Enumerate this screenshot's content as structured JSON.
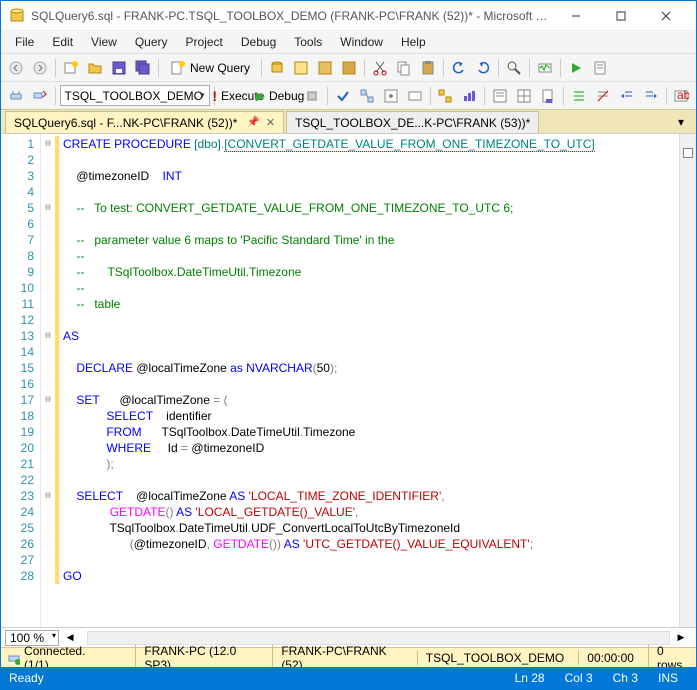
{
  "window": {
    "title": "SQLQuery6.sql - FRANK-PC.TSQL_TOOLBOX_DEMO (FRANK-PC\\FRANK (52))* - Microsoft SQL Ser..."
  },
  "menu": {
    "file": "File",
    "edit": "Edit",
    "view": "View",
    "query": "Query",
    "project": "Project",
    "debug": "Debug",
    "tools": "Tools",
    "window": "Window",
    "help": "Help"
  },
  "toolbar": {
    "new_query": "New Query",
    "execute": "Execute",
    "debug": "Debug",
    "database": "TSQL_TOOLBOX_DEMO"
  },
  "tabs": [
    {
      "label": "SQLQuery6.sql - F...NK-PC\\FRANK (52))*",
      "active": true
    },
    {
      "label": "TSQL_TOOLBOX_DE...K-PC\\FRANK (53))*",
      "active": false
    }
  ],
  "code": {
    "lines": [
      {
        "n": 1,
        "f": "⊟",
        "ch": "y",
        "s": [
          {
            "c": "kw",
            "t": "CREATE"
          },
          {
            "c": "",
            "t": " "
          },
          {
            "c": "kw",
            "t": "PROCEDURE"
          },
          {
            "c": "",
            "t": " "
          },
          {
            "c": "obj",
            "t": "[dbo]"
          },
          {
            "c": "op",
            "t": "."
          },
          {
            "c": "obj red-squig",
            "t": "[CONVERT_GETDATE_VALUE_FROM_ONE_TIMEZONE_TO_UTC]"
          }
        ]
      },
      {
        "n": 2,
        "f": "",
        "ch": "y",
        "s": []
      },
      {
        "n": 3,
        "f": "",
        "ch": "y",
        "s": [
          {
            "c": "",
            "t": "    @timezoneID    "
          },
          {
            "c": "kw",
            "t": "INT"
          }
        ]
      },
      {
        "n": 4,
        "f": "",
        "ch": "y",
        "s": []
      },
      {
        "n": 5,
        "f": "⊟",
        "ch": "y",
        "s": [
          {
            "c": "",
            "t": "    "
          },
          {
            "c": "com",
            "t": "--   To test: CONVERT_GETDATE_VALUE_FROM_ONE_TIMEZONE_TO_UTC 6;"
          }
        ]
      },
      {
        "n": 6,
        "f": "",
        "ch": "y",
        "s": []
      },
      {
        "n": 7,
        "f": "",
        "ch": "y",
        "s": [
          {
            "c": "",
            "t": "    "
          },
          {
            "c": "com",
            "t": "--   parameter value 6 maps to 'Pacific Standard Time' in the"
          }
        ]
      },
      {
        "n": 8,
        "f": "",
        "ch": "y",
        "s": [
          {
            "c": "",
            "t": "    "
          },
          {
            "c": "com",
            "t": "--"
          }
        ]
      },
      {
        "n": 9,
        "f": "",
        "ch": "y",
        "s": [
          {
            "c": "",
            "t": "    "
          },
          {
            "c": "com",
            "t": "--       TSqlToolbox.DateTimeUtil.Timezone"
          }
        ]
      },
      {
        "n": 10,
        "f": "",
        "ch": "y",
        "s": [
          {
            "c": "",
            "t": "    "
          },
          {
            "c": "com",
            "t": "--"
          }
        ]
      },
      {
        "n": 11,
        "f": "",
        "ch": "y",
        "s": [
          {
            "c": "",
            "t": "    "
          },
          {
            "c": "com",
            "t": "--   table"
          }
        ]
      },
      {
        "n": 12,
        "f": "",
        "ch": "y",
        "s": []
      },
      {
        "n": 13,
        "f": "⊟",
        "ch": "y",
        "s": [
          {
            "c": "kw",
            "t": "AS"
          }
        ]
      },
      {
        "n": 14,
        "f": "",
        "ch": "y",
        "s": []
      },
      {
        "n": 15,
        "f": "",
        "ch": "y",
        "s": [
          {
            "c": "",
            "t": "    "
          },
          {
            "c": "kw",
            "t": "DECLARE"
          },
          {
            "c": "",
            "t": " @localTimeZone "
          },
          {
            "c": "kw",
            "t": "as"
          },
          {
            "c": "",
            "t": " "
          },
          {
            "c": "kw",
            "t": "NVARCHAR"
          },
          {
            "c": "op",
            "t": "("
          },
          {
            "c": "num",
            "t": "50"
          },
          {
            "c": "op",
            "t": ");"
          }
        ]
      },
      {
        "n": 16,
        "f": "",
        "ch": "y",
        "s": []
      },
      {
        "n": 17,
        "f": "⊟",
        "ch": "y",
        "s": [
          {
            "c": "",
            "t": "    "
          },
          {
            "c": "kw",
            "t": "SET"
          },
          {
            "c": "",
            "t": "      @localTimeZone "
          },
          {
            "c": "op",
            "t": "= ("
          }
        ]
      },
      {
        "n": 18,
        "f": "",
        "ch": "y",
        "s": [
          {
            "c": "",
            "t": "             "
          },
          {
            "c": "kw",
            "t": "SELECT"
          },
          {
            "c": "",
            "t": "    identifier"
          }
        ]
      },
      {
        "n": 19,
        "f": "",
        "ch": "y",
        "s": [
          {
            "c": "",
            "t": "             "
          },
          {
            "c": "kw",
            "t": "FROM"
          },
          {
            "c": "",
            "t": "      TSqlToolbox"
          },
          {
            "c": "op",
            "t": "."
          },
          {
            "c": "",
            "t": "DateTimeUtil"
          },
          {
            "c": "op",
            "t": "."
          },
          {
            "c": "",
            "t": "Timezone"
          }
        ]
      },
      {
        "n": 20,
        "f": "",
        "ch": "y",
        "s": [
          {
            "c": "",
            "t": "             "
          },
          {
            "c": "kw",
            "t": "WHERE"
          },
          {
            "c": "",
            "t": "     Id "
          },
          {
            "c": "op",
            "t": "="
          },
          {
            "c": "",
            "t": " @timezoneID"
          }
        ]
      },
      {
        "n": 21,
        "f": "",
        "ch": "y",
        "s": [
          {
            "c": "",
            "t": "             "
          },
          {
            "c": "op",
            "t": ");"
          }
        ]
      },
      {
        "n": 22,
        "f": "",
        "ch": "y",
        "s": []
      },
      {
        "n": 23,
        "f": "⊟",
        "ch": "y",
        "s": [
          {
            "c": "",
            "t": "    "
          },
          {
            "c": "kw",
            "t": "SELECT"
          },
          {
            "c": "",
            "t": "    @localTimeZone "
          },
          {
            "c": "kw",
            "t": "AS"
          },
          {
            "c": "",
            "t": " "
          },
          {
            "c": "str",
            "t": "'LOCAL_TIME_ZONE_IDENTIFIER'"
          },
          {
            "c": "op",
            "t": ","
          }
        ]
      },
      {
        "n": 24,
        "f": "",
        "ch": "y",
        "s": [
          {
            "c": "",
            "t": "              "
          },
          {
            "c": "func",
            "t": "GETDATE"
          },
          {
            "c": "op",
            "t": "()"
          },
          {
            "c": "",
            "t": " "
          },
          {
            "c": "kw",
            "t": "AS"
          },
          {
            "c": "",
            "t": " "
          },
          {
            "c": "str",
            "t": "'LOCAL_GETDATE()_VALUE'"
          },
          {
            "c": "op",
            "t": ","
          }
        ]
      },
      {
        "n": 25,
        "f": "",
        "ch": "y",
        "s": [
          {
            "c": "",
            "t": "              TSqlToolbox"
          },
          {
            "c": "op",
            "t": "."
          },
          {
            "c": "",
            "t": "DateTimeUtil"
          },
          {
            "c": "op",
            "t": "."
          },
          {
            "c": "",
            "t": "UDF_ConvertLocalToUtcByTimezoneId"
          }
        ]
      },
      {
        "n": 26,
        "f": "",
        "ch": "y",
        "s": [
          {
            "c": "",
            "t": "                    "
          },
          {
            "c": "op",
            "t": "("
          },
          {
            "c": "",
            "t": "@timezoneID"
          },
          {
            "c": "op",
            "t": ", "
          },
          {
            "c": "func",
            "t": "GETDATE"
          },
          {
            "c": "op",
            "t": "())"
          },
          {
            "c": "",
            "t": " "
          },
          {
            "c": "kw",
            "t": "AS"
          },
          {
            "c": "",
            "t": " "
          },
          {
            "c": "str",
            "t": "'UTC_GETDATE()_VALUE_EQUIVALENT'"
          },
          {
            "c": "op",
            "t": ";"
          }
        ]
      },
      {
        "n": 27,
        "f": "",
        "ch": "y",
        "s": []
      },
      {
        "n": 28,
        "f": "",
        "ch": "y",
        "s": [
          {
            "c": "kw",
            "t": "GO"
          }
        ]
      }
    ]
  },
  "zoom": {
    "value": "100 %"
  },
  "status_yellow": {
    "connected": "Connected. (1/1)",
    "server": "FRANK-PC (12.0 SP3)",
    "user": "FRANK-PC\\FRANK (52)",
    "db": "TSQL_TOOLBOX_DEMO",
    "time": "00:00:00",
    "rows": "0 rows"
  },
  "status_blue": {
    "ready": "Ready",
    "ln": "Ln 28",
    "col": "Col 3",
    "ch": "Ch 3",
    "ins": "INS"
  }
}
